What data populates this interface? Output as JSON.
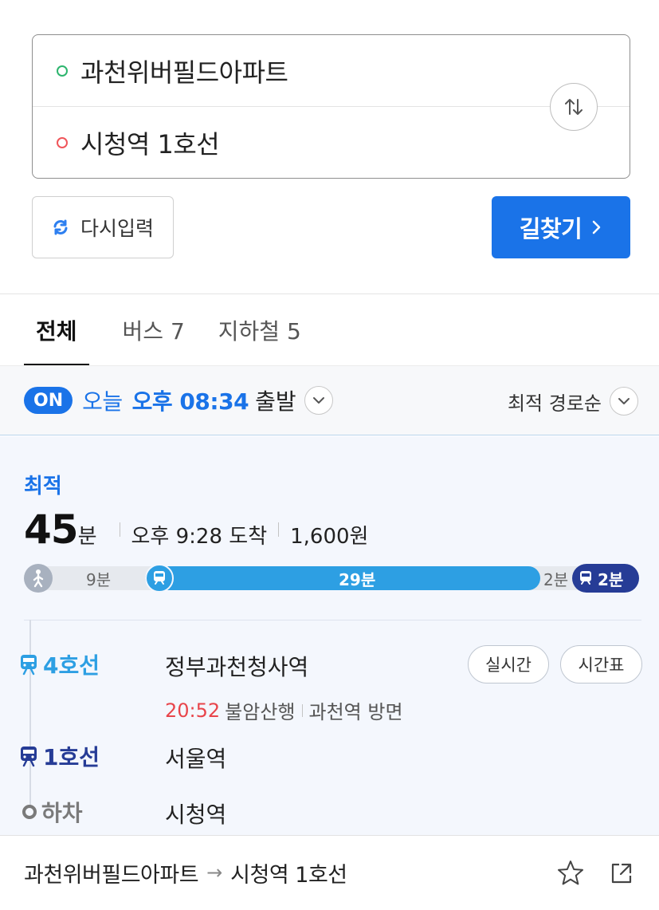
{
  "search": {
    "origin": "과천위버필드아파트",
    "destination": "시청역 1호선"
  },
  "actions": {
    "reset_label": "다시입력",
    "find_label": "길찾기"
  },
  "tabs": [
    {
      "label": "전체",
      "active": true
    },
    {
      "label": "버스 7",
      "active": false
    },
    {
      "label": "지하철 5",
      "active": false
    }
  ],
  "departure": {
    "toggle": "ON",
    "day": "오늘",
    "time": "오후 08:34",
    "suffix": "출발",
    "sort": "최적 경로순"
  },
  "result": {
    "badge": "최적",
    "duration_num": "45",
    "duration_unit": "분",
    "arrival": "오후 9:28 도착",
    "fare": "1,600원",
    "segments": {
      "walk": "9분",
      "line4": "29분",
      "transfer": "2분",
      "line1": "2분"
    },
    "steps": [
      {
        "line": "4호선",
        "station": "정부과천청사역",
        "color": "#2d9fe3"
      },
      {
        "line": "1호선",
        "station": "서울역",
        "color": "#263c96"
      },
      {
        "line": "하차",
        "station": "시청역",
        "color": "#7a7a7a"
      }
    ],
    "arrival_info": {
      "time": "20:52",
      "direction": "불암산행",
      "exit": "과천역 방면"
    },
    "buttons": {
      "realtime": "실시간",
      "timetable": "시간표"
    }
  },
  "footer": {
    "from": "과천위버필드아파트",
    "arrow": "→",
    "to": "시청역 1호선"
  },
  "colors": {
    "accent": "#1a73e8",
    "line4": "#2d9fe3",
    "line1": "#263c96",
    "time_red": "#e8454b"
  }
}
